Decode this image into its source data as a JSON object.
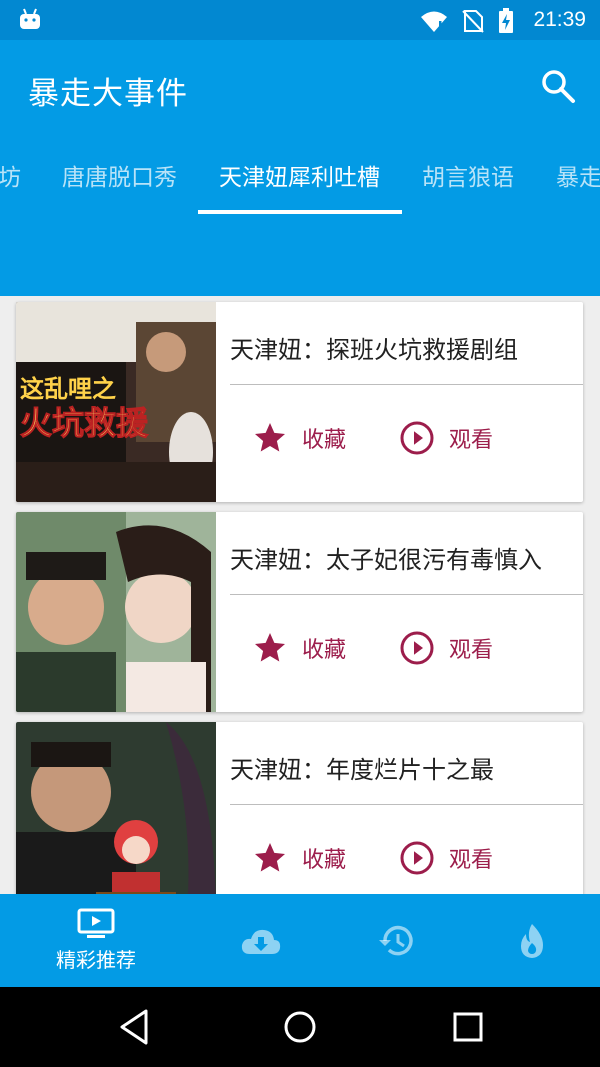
{
  "status_bar": {
    "time": "21:39"
  },
  "app_bar": {
    "title": "暴走大事件"
  },
  "tabs": [
    {
      "label": "坊"
    },
    {
      "label": "唐唐脱口秀"
    },
    {
      "label": "天津妞犀利吐槽"
    },
    {
      "label": "胡言狼语"
    },
    {
      "label": "暴走"
    }
  ],
  "active_tab": "天津妞犀利吐槽",
  "cards": [
    {
      "title": "天津妞：探班火坑救援剧组",
      "poster_text_1": "这乱哩之",
      "poster_text_2": "火坑救援",
      "fav_label": "收藏",
      "watch_label": "观看"
    },
    {
      "title": "天津妞：太子妃很污有毒慎入",
      "fav_label": "收藏",
      "watch_label": "观看"
    },
    {
      "title": "天津妞：年度烂片十之最",
      "fav_label": "收藏",
      "watch_label": "观看"
    }
  ],
  "bottom_nav": [
    {
      "label": "精彩推荐",
      "icon": "tv-icon",
      "active": true
    },
    {
      "icon": "cloud-download-icon"
    },
    {
      "icon": "history-icon"
    },
    {
      "icon": "flame-icon"
    }
  ],
  "colors": {
    "primary": "#039be5",
    "status_bar": "#0288d1",
    "accent": "#9c1d4b"
  }
}
